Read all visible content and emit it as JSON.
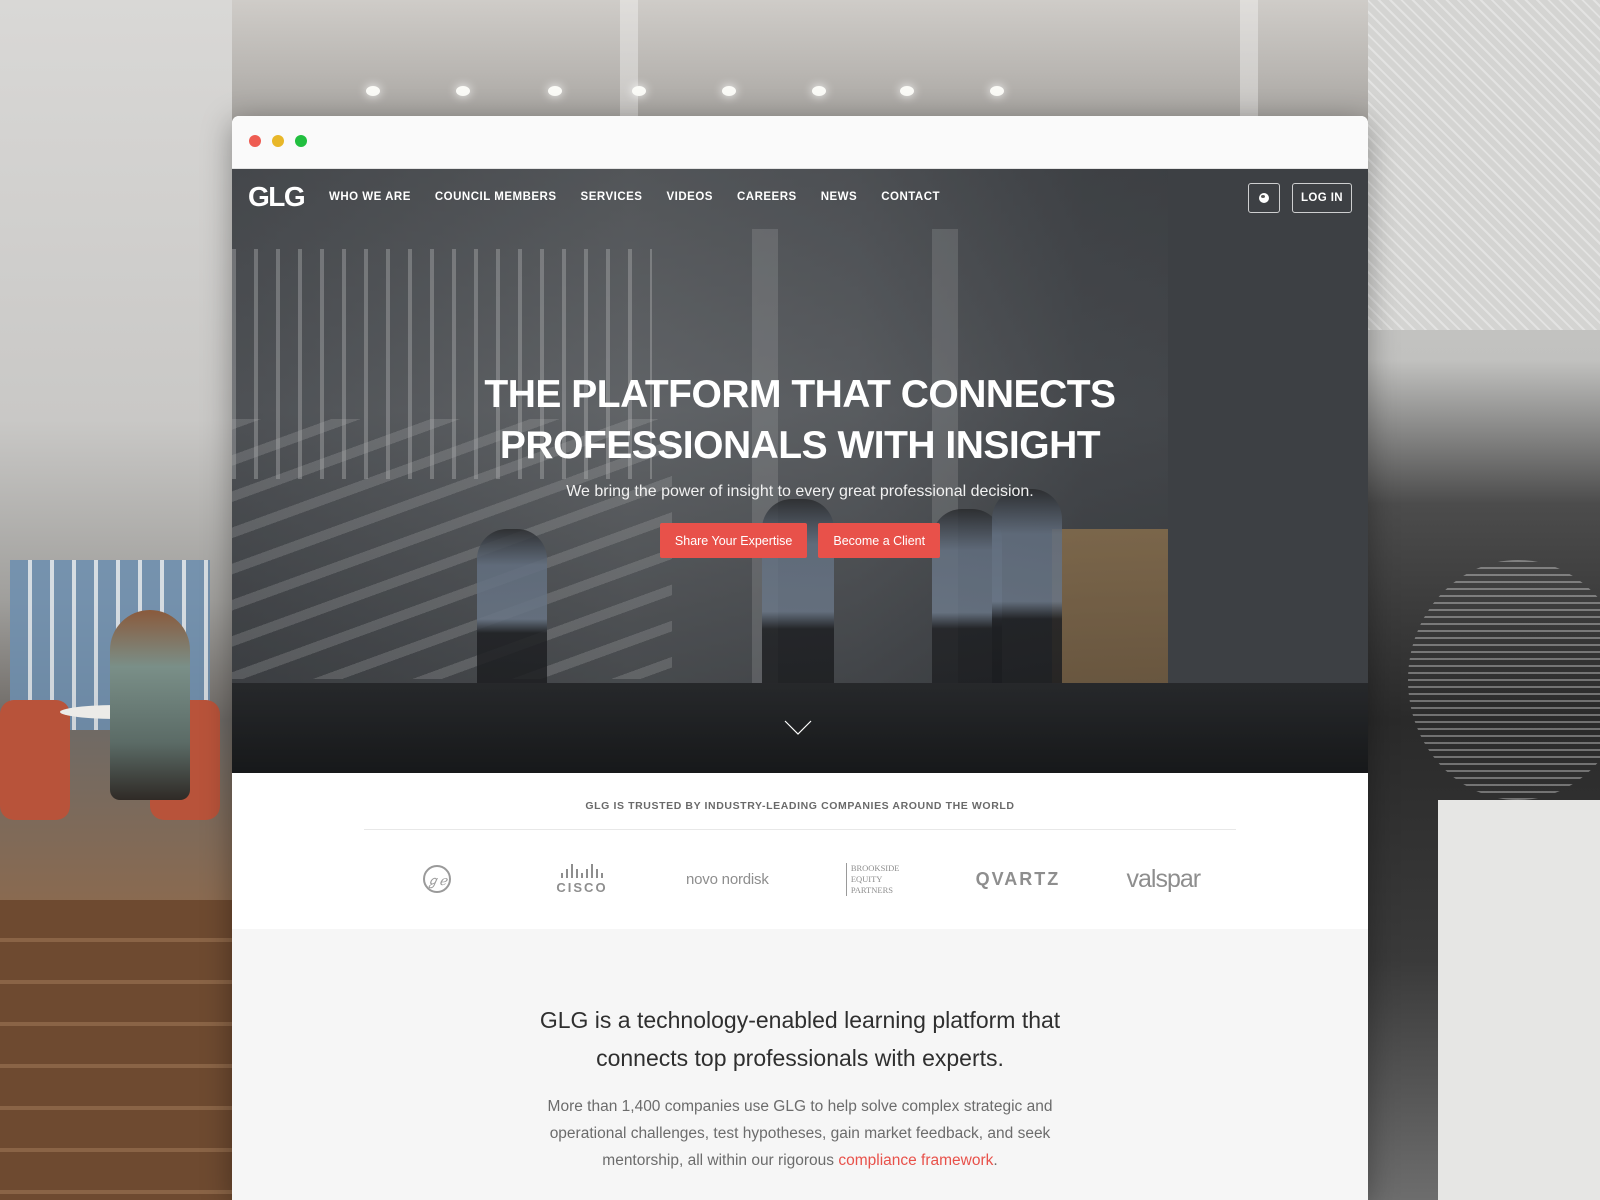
{
  "browser": {
    "controls": [
      "close",
      "minimize",
      "maximize"
    ]
  },
  "nav": {
    "logo": "GLG",
    "links": [
      "WHO WE ARE",
      "COUNCIL MEMBERS",
      "SERVICES",
      "VIDEOS",
      "CAREERS",
      "NEWS",
      "CONTACT"
    ],
    "globe_icon": "globe-icon",
    "login_label": "LOG IN"
  },
  "hero": {
    "title_line1": "THE PLATFORM THAT CONNECTS",
    "title_line2": "PROFESSIONALS WITH INSIGHT",
    "subtitle": "We bring the power of insight to every great professional decision.",
    "primary_cta": "Share Your Expertise",
    "secondary_cta": "Become a Client",
    "scroll_icon": "chevron-down-icon"
  },
  "trusted": {
    "title": "GLG IS TRUSTED BY INDUSTRY-LEADING COMPANIES AROUND THE WORLD",
    "logos": {
      "ge": "GE",
      "cisco": "CISCO",
      "novo": "novo nordisk",
      "brookside": [
        "BROOKSIDE",
        "EQUITY",
        "PARTNERS"
      ],
      "qvartz": "QVARTZ",
      "valspar": "valspar"
    }
  },
  "about": {
    "title_line1": "GLG is a technology-enabled learning platform that",
    "title_line2": "connects top professionals with experts.",
    "body_before": "More than 1,400 companies use GLG to help solve complex strategic and operational challenges, test hypotheses, gain market feedback, and seek mentorship, all within our rigorous ",
    "body_link": "compliance framework",
    "body_after": "."
  },
  "colors": {
    "accent_red": "#e8514a",
    "nav_text": "#ffffff",
    "about_bg": "#f6f6f6"
  }
}
